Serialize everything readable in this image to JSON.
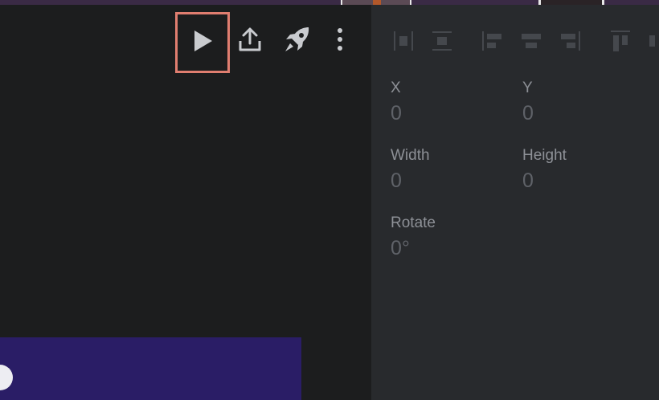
{
  "toolbar": {
    "play_icon": "play-icon",
    "export_icon": "upload-icon",
    "launch_icon": "rocket-icon",
    "more_icon": "more-vertical-icon"
  },
  "align_tools": [
    "distribute-horizontal-icon",
    "align-center-vertical-icon",
    "align-left-icon",
    "align-center-horizontal-icon",
    "align-right-icon",
    "align-top-icon"
  ],
  "properties": {
    "x_label": "X",
    "x_value": "0",
    "y_label": "Y",
    "y_value": "0",
    "width_label": "Width",
    "width_value": "0",
    "height_label": "Height",
    "height_value": "0",
    "rotate_label": "Rotate",
    "rotate_value": "0°"
  },
  "colors": {
    "canvas_bg": "#1c1d1e",
    "panel_bg": "#282a2d",
    "highlight": "#e07e70",
    "preview_fill": "#2a1d66"
  }
}
